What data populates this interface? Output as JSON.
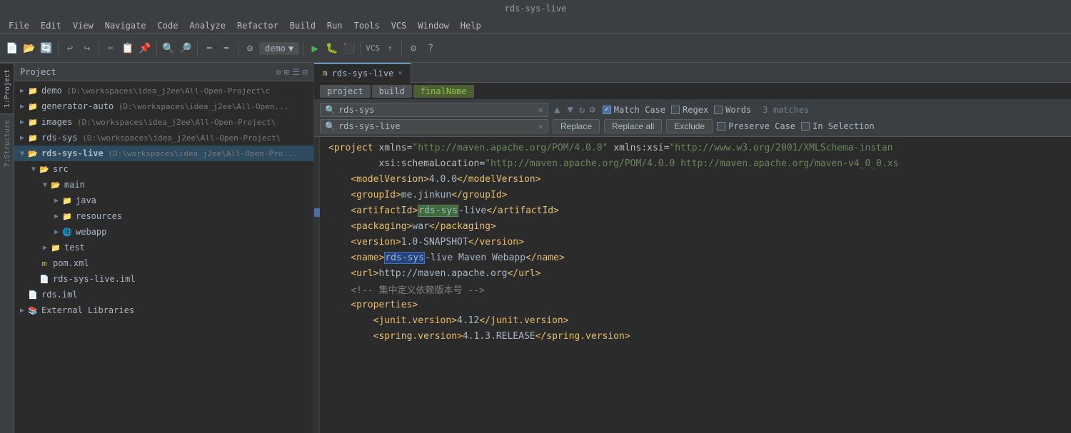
{
  "titleBar": {
    "title": "rds-sys-live"
  },
  "menuBar": {
    "items": [
      "File",
      "Edit",
      "View",
      "Navigate",
      "Code",
      "Analyze",
      "Refactor",
      "Build",
      "Run",
      "Tools",
      "VCS",
      "Window",
      "Help"
    ]
  },
  "toolbar": {
    "demoLabel": "demo",
    "demoArrow": "▼"
  },
  "verticalTabs": [
    {
      "label": "1:Project",
      "active": true
    },
    {
      "label": "7:Structure",
      "active": false
    }
  ],
  "projectPanel": {
    "title": "Project",
    "items": [
      {
        "indent": 0,
        "type": "folder",
        "label": "demo",
        "detail": "(D:\\workspaces\\idea_j2ee\\All-Open-Project\\c",
        "expanded": false
      },
      {
        "indent": 0,
        "type": "folder",
        "label": "generator-auto",
        "detail": "(D:\\workspaces\\idea_j2ee\\All-Open...",
        "expanded": false
      },
      {
        "indent": 0,
        "type": "folder",
        "label": "images",
        "detail": "(D:\\workspaces\\idea_j2ee\\All-Open-Project\\",
        "expanded": false
      },
      {
        "indent": 0,
        "type": "folder",
        "label": "rds-sys",
        "detail": "(D:\\workspaces\\idea_j2ee\\All-Open-Project\\",
        "expanded": false
      },
      {
        "indent": 0,
        "type": "folder",
        "label": "rds-sys-live",
        "detail": "(D:\\workspaces\\idea_j2ee\\All-Open-Pro...",
        "expanded": true,
        "active": true
      },
      {
        "indent": 1,
        "type": "folder",
        "label": "src",
        "expanded": true
      },
      {
        "indent": 2,
        "type": "folder",
        "label": "main",
        "expanded": true
      },
      {
        "indent": 3,
        "type": "folder",
        "label": "java",
        "expanded": false
      },
      {
        "indent": 3,
        "type": "folder",
        "label": "resources",
        "expanded": false
      },
      {
        "indent": 3,
        "type": "folder",
        "label": "webapp",
        "expanded": false
      },
      {
        "indent": 2,
        "type": "folder",
        "label": "test",
        "expanded": false
      },
      {
        "indent": 1,
        "type": "xml",
        "label": "pom.xml"
      },
      {
        "indent": 1,
        "type": "iml",
        "label": "rds-sys-live.iml"
      },
      {
        "indent": 0,
        "type": "iml",
        "label": "rds.iml"
      },
      {
        "indent": 0,
        "type": "folder",
        "label": "External Libraries",
        "expanded": false
      }
    ]
  },
  "tabs": [
    {
      "label": "rds-sys-live",
      "icon": "m",
      "active": true,
      "closeable": true
    }
  ],
  "breadcrumbs": [
    {
      "label": "project",
      "highlight": false
    },
    {
      "label": "build",
      "highlight": false
    },
    {
      "label": "finalName",
      "highlight": true
    }
  ],
  "searchBar": {
    "searchValue": "rds-sys",
    "searchPlaceholder": "",
    "replaceValue": "rds-sys-live",
    "replacePlaceholder": "",
    "matchCase": true,
    "regex": false,
    "words": false,
    "preserveCase": false,
    "inSelection": false,
    "matchesCount": "3 matches",
    "replaceBtn": "Replace",
    "replaceAllBtn": "Replace all",
    "excludeBtn": "Exclude",
    "matchCaseLabel": "Match Case",
    "regexLabel": "Regex",
    "wordsLabel": "Words",
    "preserveCaseLabel": "Preserve Case",
    "inSelectionLabel": "In Selection"
  },
  "codeLines": [
    {
      "content": "<project xmlns=\"http://maven.apache.org/POM/4.0.0\" xmlns:xsi=\"http://www.w3.org/2001/XMLSchema-instan",
      "type": "xml-header"
    },
    {
      "content": "         xsi:schemaLocation=\"http://maven.apache.org/POM/4.0.0 http://maven.apache.org/maven-v4_0_0.xs",
      "type": "xml-attr-line"
    },
    {
      "content": "    <modelVersion>4.0.0</modelVersion>",
      "type": "xml-tag-line"
    },
    {
      "content": "    <groupId>me.jinkun</groupId>",
      "type": "xml-tag-line"
    },
    {
      "content": "    <artifactId>rds-sys-live</artifactId>",
      "type": "xml-artifact-line",
      "highlight": "rds-sys"
    },
    {
      "content": "    <packaging>war</packaging>",
      "type": "xml-tag-line"
    },
    {
      "content": "    <version>1.0-SNAPSHOT</version>",
      "type": "xml-tag-line"
    },
    {
      "content": "    <name>rds-sys-live Maven Webapp</name>",
      "type": "xml-name-line",
      "highlight": "rds-sys"
    },
    {
      "content": "    <url>http://maven.apache.org</url>",
      "type": "xml-tag-line"
    },
    {
      "content": "    <!-- 集中定义依赖版本号 -->",
      "type": "xml-comment-line"
    },
    {
      "content": "    <properties>",
      "type": "xml-tag-line"
    },
    {
      "content": "        <junit.version>4.12</junit.version>",
      "type": "xml-tag-line"
    },
    {
      "content": "        <spring.version>4.1.3.RELEASE</spring.version>",
      "type": "xml-tag-line"
    }
  ]
}
